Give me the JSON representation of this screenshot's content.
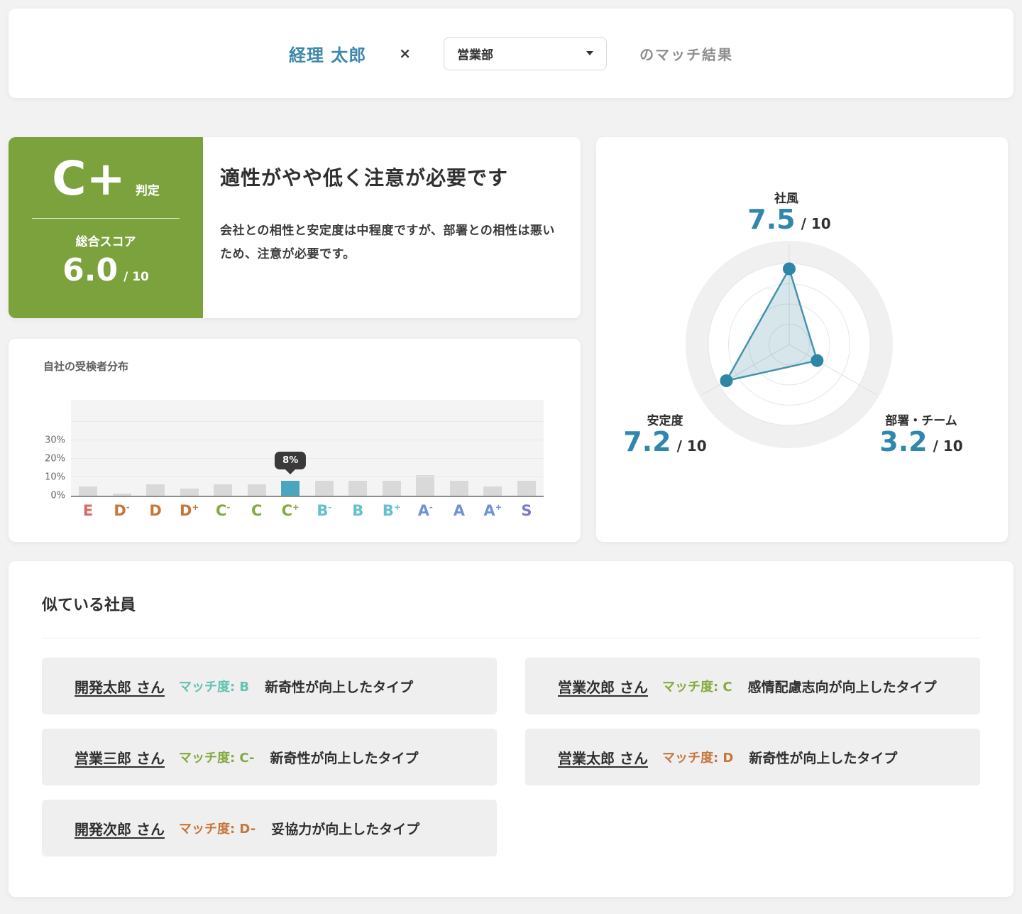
{
  "header": {
    "employee_name": "経理 太郎",
    "separator": "×",
    "department": "営業部",
    "suffix": "のマッチ結果"
  },
  "summary": {
    "grade": "C+",
    "grade_label": "判定",
    "score_label": "総合スコア",
    "score_value": "6.0",
    "score_denom": "/ 10",
    "headline": "適性がやや低く注意が必要です",
    "description": "会社との相性と安定度は中程度ですが、部署との相性は悪いため、注意が必要です。",
    "grade_bg_color": "#7ba23c"
  },
  "chart_data": [
    {
      "type": "bar",
      "title": "自社の受検者分布",
      "categories": [
        "E",
        "D-",
        "D",
        "D+",
        "C-",
        "C",
        "C+",
        "B-",
        "B",
        "B+",
        "A-",
        "A",
        "A+",
        "S"
      ],
      "values": [
        5,
        1,
        6,
        4,
        6,
        6,
        8,
        8,
        8,
        8,
        11,
        8,
        5,
        8
      ],
      "unit": "%",
      "yticks": [
        "0%",
        "10%",
        "20%",
        "30%"
      ],
      "ylim": [
        0,
        52
      ],
      "grid": true,
      "highlight_category": "C+",
      "tooltip": "8%",
      "bar_color": "#d9d9da",
      "highlight_color": "#49a6bc",
      "label_colors": [
        "#d9695f",
        "#c7763b",
        "#c7763b",
        "#c7763b",
        "#84aa3f",
        "#84aa3f",
        "#84aa3f",
        "#64bfcc",
        "#64bfcc",
        "#64bfcc",
        "#7191d6",
        "#7191d6",
        "#7191d6",
        "#7b78d2"
      ]
    },
    {
      "type": "radar",
      "axes": [
        "社風",
        "部署・チーム",
        "安定度"
      ],
      "values": [
        7.5,
        3.2,
        7.2
      ],
      "max": 10,
      "rings": 5,
      "stroke_color": "#4493ae",
      "dot_color": "#2e86a6",
      "fill_color": "rgba(73,142,166,0.22)"
    }
  ],
  "radar": {
    "axes": [
      {
        "label": "社風",
        "value": "7.5",
        "denom": "/ 10"
      },
      {
        "label": "部署・チーム",
        "value": "3.2",
        "denom": "/ 10"
      },
      {
        "label": "安定度",
        "value": "7.2",
        "denom": "/ 10"
      }
    ]
  },
  "similar": {
    "heading": "似ている社員",
    "match_prefix": "マッチ度:",
    "items": [
      {
        "name": "開発太郎 さん",
        "grade": "B",
        "grade_color": "#63c2b0",
        "type": "新奇性が向上したタイプ"
      },
      {
        "name": "営業次郎 さん",
        "grade": "C",
        "grade_color": "#84aa3f",
        "type": "感情配慮志向が向上したタイプ"
      },
      {
        "name": "営業三郎 さん",
        "grade": "C-",
        "grade_color": "#84aa3f",
        "type": "新奇性が向上したタイプ"
      },
      {
        "name": "営業太郎 さん",
        "grade": "D",
        "grade_color": "#c7763b",
        "type": "新奇性が向上したタイプ"
      },
      {
        "name": "開発次郎 さん",
        "grade": "D-",
        "grade_color": "#c7763b",
        "type": "妥協力が向上したタイプ"
      }
    ]
  },
  "colors": {
    "page_bg": "#f2f2f3",
    "accent_green": "#7ba23c",
    "accent_teal": "#2f87ab",
    "tooltip_bg": "#3a3a3a"
  }
}
